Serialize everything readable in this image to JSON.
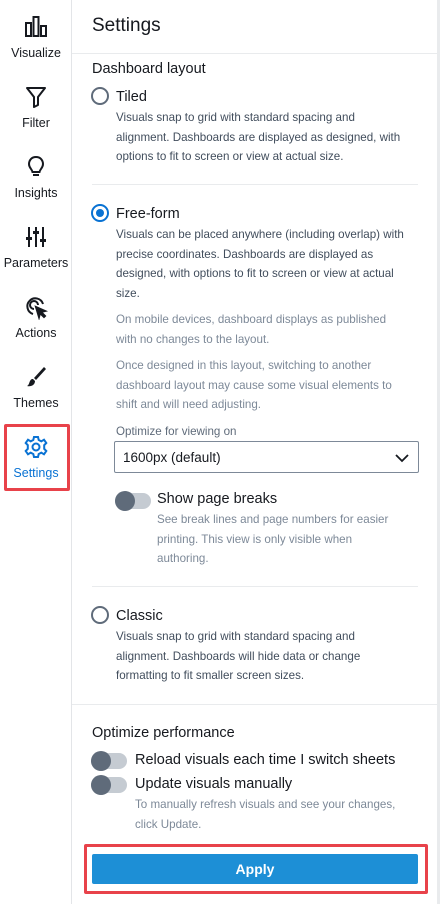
{
  "sidebar": {
    "items": [
      {
        "label": "Visualize",
        "icon": "bar-chart-icon"
      },
      {
        "label": "Filter",
        "icon": "filter-icon"
      },
      {
        "label": "Insights",
        "icon": "lightbulb-icon"
      },
      {
        "label": "Parameters",
        "icon": "sliders-icon"
      },
      {
        "label": "Actions",
        "icon": "cursor-click-icon"
      },
      {
        "label": "Themes",
        "icon": "brush-icon"
      },
      {
        "label": "Settings",
        "icon": "gear-icon"
      }
    ],
    "active": "Settings"
  },
  "panel": {
    "title": "Settings",
    "layout": {
      "title": "Dashboard layout",
      "tiled": {
        "label": "Tiled",
        "desc_lines": [
          "Visuals snap to grid with standard spacing and",
          "alignment. Dashboards are displayed as designed, with",
          "options to fit to screen or view at actual size."
        ]
      },
      "freeform": {
        "label": "Free-form",
        "desc_lines": [
          "Visuals can be placed anywhere (including overlap) with",
          "precise coordinates. Dashboards are displayed as",
          "designed, with options to fit to screen or view at actual",
          "size."
        ],
        "mobile_lines": [
          "On mobile devices, dashboard displays as published",
          "with no changes to the layout."
        ],
        "switch_lines": [
          "Once designed in this layout, switching to another",
          "dashboard layout may cause some visual elements to",
          "shift and will need adjusting."
        ],
        "optimize_label": "Optimize for viewing on",
        "optimize_value": "1600px (default)",
        "page_breaks": {
          "label": "Show page breaks",
          "desc_lines": [
            "See break lines and page numbers for easier",
            "printing. This view is only visible when",
            "authoring."
          ]
        }
      },
      "classic": {
        "label": "Classic",
        "desc_lines": [
          "Visuals snap to grid with standard spacing and",
          "alignment. Dashboards will hide data or change",
          "formatting to fit smaller screen sizes."
        ]
      },
      "selected": "Free-form"
    },
    "performance": {
      "title": "Optimize performance",
      "reload_label": "Reload visuals each time I switch sheets",
      "manual_label": "Update visuals manually",
      "manual_desc_lines": [
        "To manually refresh visuals and see your changes,",
        "click Update."
      ]
    },
    "apply_label": "Apply"
  },
  "colors": {
    "accent": "#0972d3",
    "apply_button": "#1d8fd6",
    "highlight": "#e8424a"
  }
}
